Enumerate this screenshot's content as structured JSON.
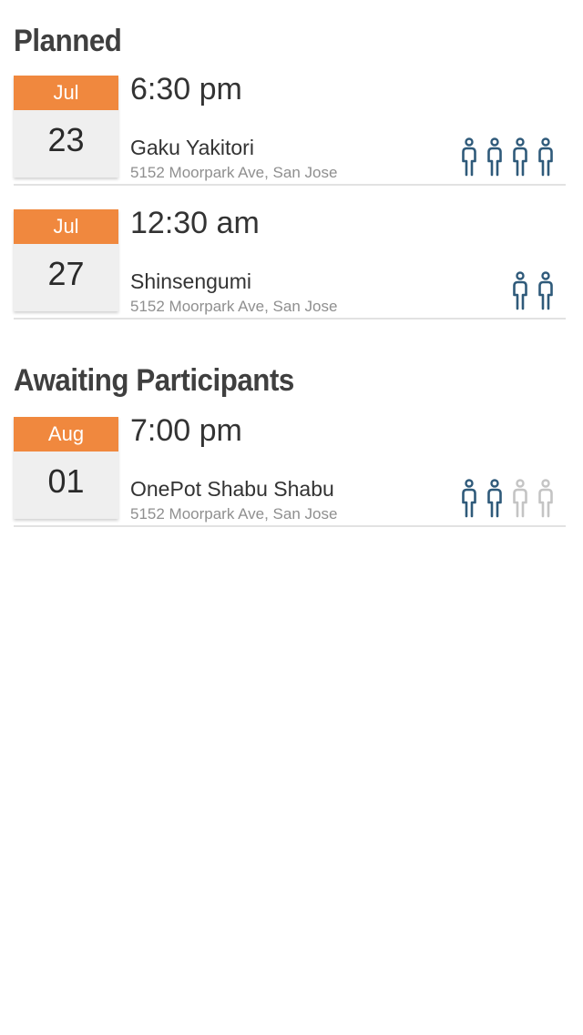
{
  "colors": {
    "accent": "#f0883e",
    "participant_filled": "#2f5a7a",
    "participant_empty": "#c4c4c4"
  },
  "sections": [
    {
      "title": "Planned",
      "events": [
        {
          "month": "Jul",
          "day": "23",
          "time": "6:30 pm",
          "name": "Gaku Yakitori",
          "address": "5152 Moorpark Ave, San Jose",
          "participants": [
            "filled",
            "filled",
            "filled",
            "filled"
          ]
        },
        {
          "month": "Jul",
          "day": "27",
          "time": "12:30 am",
          "name": "Shinsengumi",
          "address": "5152 Moorpark Ave, San Jose",
          "participants": [
            "filled",
            "filled"
          ]
        }
      ]
    },
    {
      "title": "Awaiting Participants",
      "events": [
        {
          "month": "Aug",
          "day": "01",
          "time": "7:00 pm",
          "name": "OnePot Shabu Shabu",
          "address": "5152 Moorpark Ave, San Jose",
          "participants": [
            "filled",
            "filled",
            "empty",
            "empty"
          ]
        }
      ]
    }
  ]
}
